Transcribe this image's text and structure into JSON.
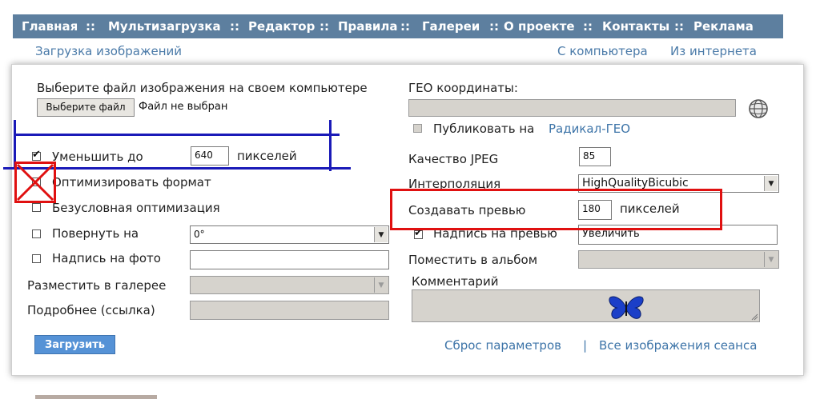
{
  "nav": {
    "items": [
      "Главная",
      "Мультизагрузка",
      "Редактор",
      "Правила",
      "Галереи",
      "О проекте",
      "Контакты",
      "Реклама"
    ],
    "separator": "::"
  },
  "subnav": {
    "left": "Загрузка изображений",
    "from_computer": "С компьютера",
    "from_internet": "Из интернета"
  },
  "left": {
    "choose_file_prompt": "Выберите файл изображения на своем компьютере",
    "choose_file_button": "Выберите файл",
    "no_file": "Файл не выбран",
    "reduce_label": "Уменьшить до",
    "reduce_value": "640",
    "reduce_unit": "пикселей",
    "optimize_label": "Оптимизировать формат",
    "unconditional_label": "Безусловная оптимизация",
    "rotate_label": "Повернуть на",
    "rotate_value": "0°",
    "caption_label": "Надпись на фото",
    "caption_value": "",
    "gallery_label": "Разместить в галерее",
    "more_label": "Подробнее (ссылка)",
    "upload_button": "Загрузить"
  },
  "right": {
    "geo_label": "ГЕО координаты:",
    "publish_label": "Публиковать на",
    "publish_link": "Радикал-ГЕО",
    "jpeg_label": "Качество JPEG",
    "jpeg_value": "85",
    "interp_label": "Интерполяция",
    "interp_value": "HighQualityBicubic",
    "preview_label": "Создавать превью",
    "preview_value": "180",
    "preview_unit": "пикселей",
    "preview_caption_label": "Надпись на превью",
    "preview_caption_value": "Увеличить",
    "album_label": "Поместить в альбом",
    "comment_label": "Комментарий",
    "reset_link": "Сброс параметров",
    "link_sep": "|",
    "all_images_link": "Все изображения сеанса"
  },
  "colors": {
    "nav_bg": "#5d7f9f",
    "link": "#3d74a8",
    "annotation_blue": "#1a1ab8",
    "annotation_red": "#e01010"
  },
  "icons": [
    "globe-icon",
    "butterfly-icon",
    "resize-grip-icon",
    "chevron-down-icon"
  ]
}
